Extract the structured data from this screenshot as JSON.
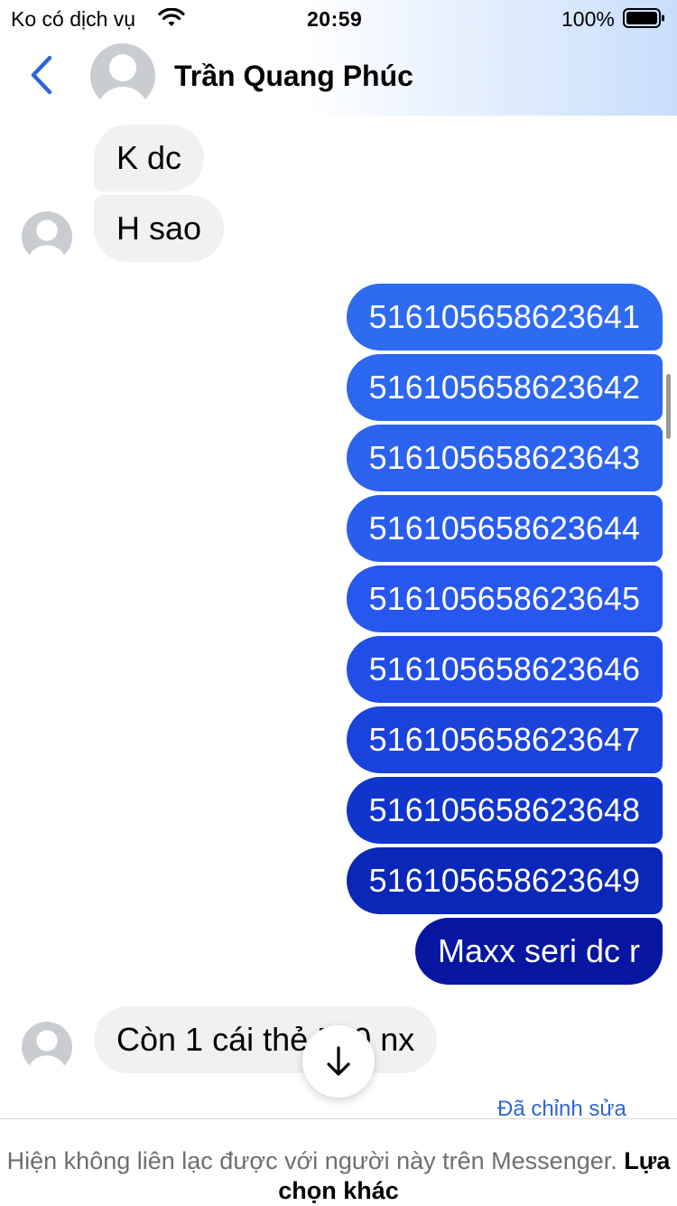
{
  "status_bar": {
    "carrier": "Ko có dịch vụ",
    "time": "20:59",
    "battery": "100%",
    "icons": [
      "wifi-icon",
      "battery-icon"
    ]
  },
  "header": {
    "contact_name": "Trần Quang Phúc",
    "back_icon": "chevron-left-icon"
  },
  "messages": {
    "incoming_top": [
      "K dc",
      "H sao"
    ],
    "outgoing": [
      "516105658623641",
      "516105658623642",
      "516105658623643",
      "516105658623644",
      "516105658623645",
      "516105658623646",
      "516105658623647",
      "516105658623648",
      "516105658623649",
      "Maxx seri dc r"
    ],
    "incoming_last": "Còn 1 cái thẻ 500 nx",
    "edited_label": "Đã chỉnh sửa"
  },
  "footer": {
    "notice": "Hiện không liên lạc được với người này trên Messenger.",
    "link": "Lựa chọn khác"
  },
  "colors": {
    "accent": "#2e66d6",
    "incoming_bubble": "#f1f1f4",
    "outgoing_gradient": [
      "#2e6bf0",
      "#2857ee",
      "#1a3ed8",
      "#0a23b8",
      "#0716a0"
    ]
  }
}
